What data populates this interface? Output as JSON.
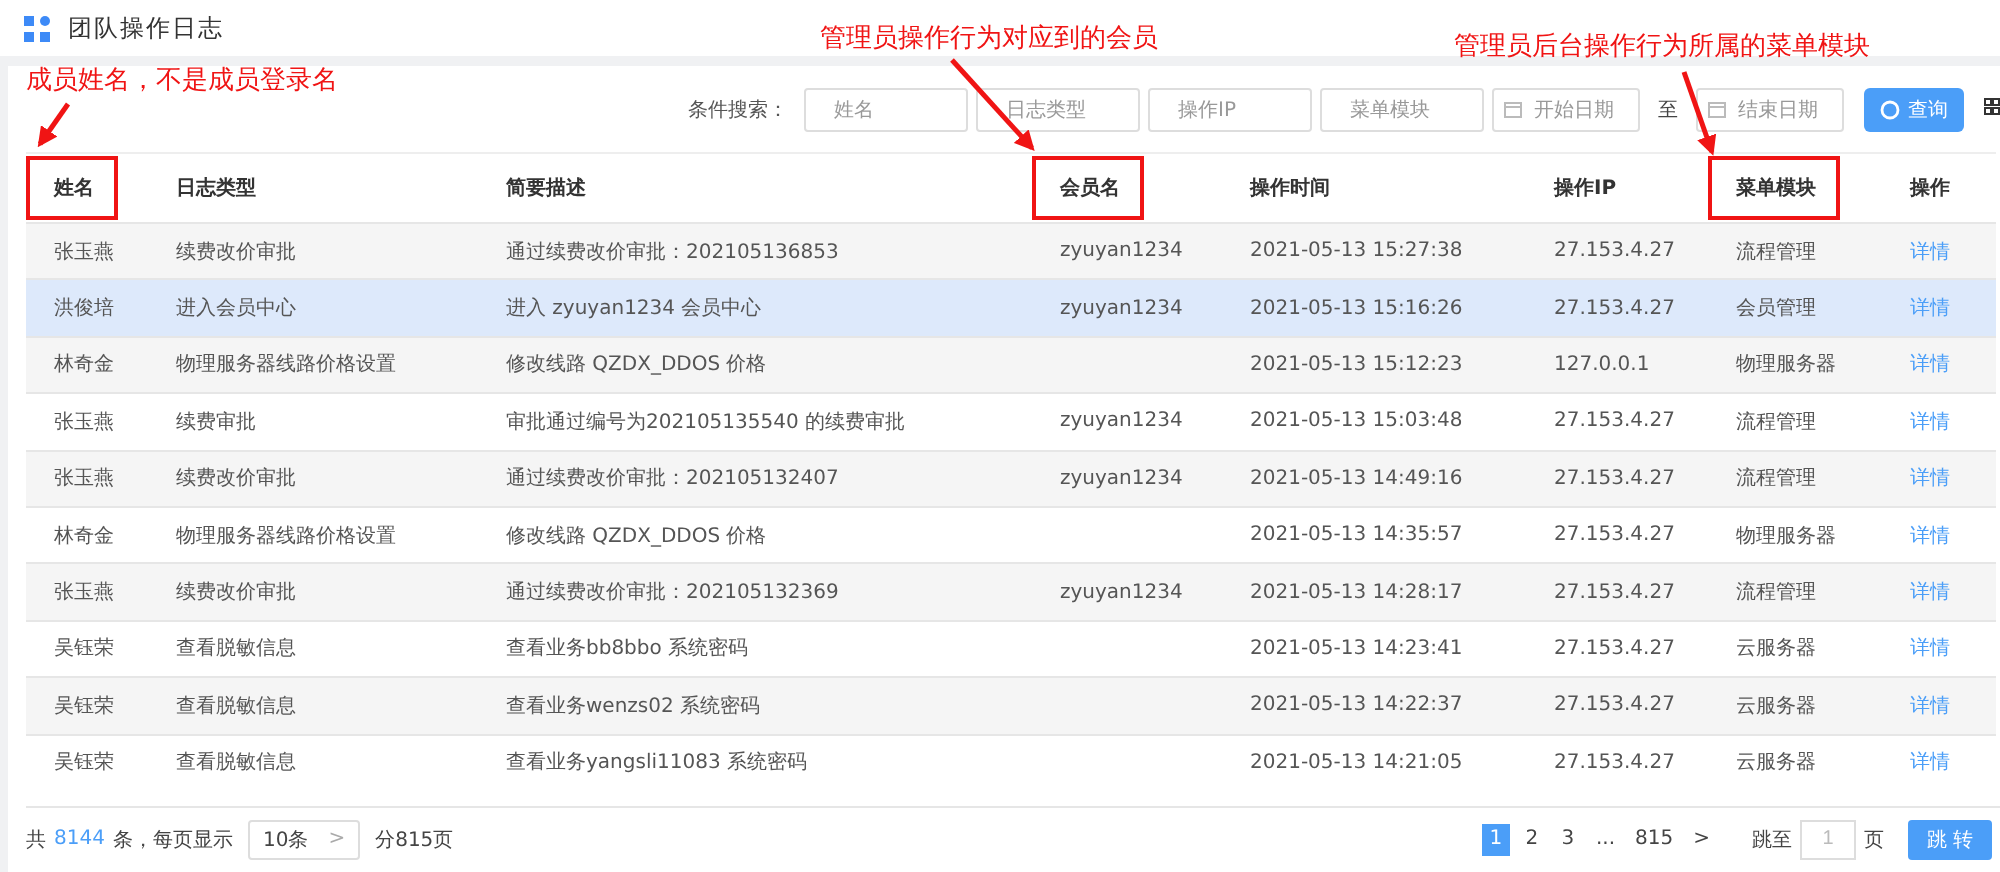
{
  "page": {
    "title": "团队操作日志"
  },
  "annotations": [
    {
      "text": "成员姓名，不是成员登录名",
      "kind": "left"
    },
    {
      "text": "管理员操作行为对应到的会员",
      "kind": "middle"
    },
    {
      "text": "管理员后台操作行为所属的菜单模块",
      "kind": "right"
    }
  ],
  "search": {
    "label": "条件搜索：",
    "fields": [
      {
        "placeholder": "姓名",
        "kind": "text"
      },
      {
        "placeholder": "日志类型",
        "kind": "text"
      },
      {
        "placeholder": "操作IP",
        "kind": "text"
      },
      {
        "placeholder": "菜单模块",
        "kind": "text"
      },
      {
        "placeholder": "开始日期",
        "kind": "date"
      },
      {
        "placeholder": "结束日期",
        "kind": "date"
      }
    ],
    "range_separator": "至",
    "button": "查询"
  },
  "table": {
    "columns": [
      {
        "label": "姓名",
        "highlighted": true
      },
      {
        "label": "日志类型",
        "highlighted": false
      },
      {
        "label": "简要描述",
        "highlighted": false
      },
      {
        "label": "会员名",
        "highlighted": true
      },
      {
        "label": "操作时间",
        "highlighted": false
      },
      {
        "label": "操作IP",
        "highlighted": false
      },
      {
        "label": "菜单模块",
        "highlighted": true
      },
      {
        "label": "操作",
        "highlighted": false
      }
    ],
    "rows": [
      {
        "selected": false,
        "cells": [
          "张玉燕",
          "续费改价审批",
          "通过续费改价审批：202105136853",
          "zyuyan1234",
          "2021-05-13 15:27:38",
          "27.153.4.27",
          "流程管理",
          "详情"
        ]
      },
      {
        "selected": true,
        "cells": [
          "洪俊培",
          "进入会员中心",
          "进入 zyuyan1234 会员中心",
          "zyuyan1234",
          "2021-05-13 15:16:26",
          "27.153.4.27",
          "会员管理",
          "详情"
        ]
      },
      {
        "selected": false,
        "cells": [
          "林奇金",
          "物理服务器线路价格设置",
          "修改线路 QZDX_DDOS 价格",
          "",
          "2021-05-13 15:12:23",
          "127.0.0.1",
          "物理服务器",
          "详情"
        ]
      },
      {
        "selected": false,
        "cells": [
          "张玉燕",
          "续费审批",
          "审批通过编号为202105135540 的续费审批",
          "zyuyan1234",
          "2021-05-13 15:03:48",
          "27.153.4.27",
          "流程管理",
          "详情"
        ]
      },
      {
        "selected": false,
        "cells": [
          "张玉燕",
          "续费改价审批",
          "通过续费改价审批：202105132407",
          "zyuyan1234",
          "2021-05-13 14:49:16",
          "27.153.4.27",
          "流程管理",
          "详情"
        ]
      },
      {
        "selected": false,
        "cells": [
          "林奇金",
          "物理服务器线路价格设置",
          "修改线路 QZDX_DDOS 价格",
          "",
          "2021-05-13 14:35:57",
          "27.153.4.27",
          "物理服务器",
          "详情"
        ]
      },
      {
        "selected": false,
        "cells": [
          "张玉燕",
          "续费改价审批",
          "通过续费改价审批：202105132369",
          "zyuyan1234",
          "2021-05-13 14:28:17",
          "27.153.4.27",
          "流程管理",
          "详情"
        ]
      },
      {
        "selected": false,
        "cells": [
          "吴钰荣",
          "查看脱敏信息",
          "查看业务bb8bbo 系统密码",
          "",
          "2021-05-13 14:23:41",
          "27.153.4.27",
          "云服务器",
          "详情"
        ]
      },
      {
        "selected": false,
        "cells": [
          "吴钰荣",
          "查看脱敏信息",
          "查看业务wenzs02 系统密码",
          "",
          "2021-05-13 14:22:37",
          "27.153.4.27",
          "云服务器",
          "详情"
        ]
      },
      {
        "selected": false,
        "cells": [
          "吴钰荣",
          "查看脱敏信息",
          "查看业务yangsli11083 系统密码",
          "",
          "2021-05-13 14:21:05",
          "27.153.4.27",
          "云服务器",
          "详情"
        ]
      }
    ]
  },
  "footer": {
    "total_prefix": "共",
    "total": "8144",
    "total_suffix": "条，每页显示",
    "page_size": "10条",
    "page_size_caret": ">",
    "page_count": "分815页",
    "pages": [
      {
        "label": "1",
        "selected": true
      },
      {
        "label": "2",
        "selected": false
      },
      {
        "label": "3",
        "selected": false
      },
      {
        "label": "...",
        "selected": false
      },
      {
        "label": "815",
        "selected": false
      }
    ],
    "next": ">",
    "jump_label": "跳至",
    "jump_value": "1",
    "jump_unit": "页",
    "jump_button": "跳 转"
  }
}
